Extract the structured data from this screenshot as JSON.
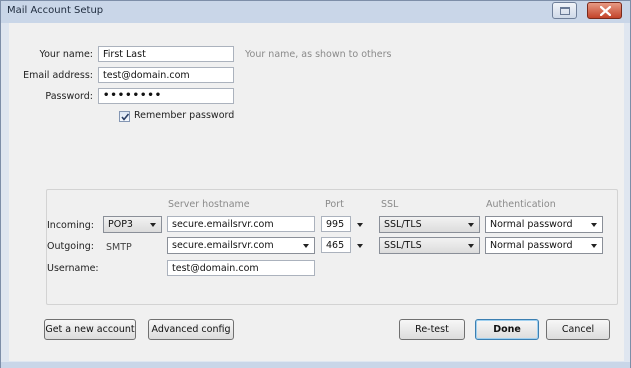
{
  "window": {
    "title": "Mail Account Setup"
  },
  "identity": {
    "name_label": "Your name:",
    "name_value": "First Last",
    "name_hint": "Your name, as shown to others",
    "email_label": "Email address:",
    "email_value": "test@domain.com",
    "password_label": "Password:",
    "password_value": "••••••••",
    "remember_label": "Remember password",
    "remember_checked": true
  },
  "server": {
    "headers": {
      "hostname": "Server hostname",
      "port": "Port",
      "ssl": "SSL",
      "auth": "Authentication"
    },
    "incoming": {
      "label": "Incoming:",
      "protocol": "POP3",
      "hostname": "secure.emailsrvr.com",
      "port": "995",
      "ssl": "SSL/TLS",
      "auth": "Normal password"
    },
    "outgoing": {
      "label": "Outgoing:",
      "protocol": "SMTP",
      "hostname": "secure.emailsrvr.com",
      "port": "465",
      "ssl": "SSL/TLS",
      "auth": "Normal password"
    },
    "username_label": "Username:",
    "username_value": "test@domain.com"
  },
  "buttons": {
    "new_account": "Get a new account",
    "advanced": "Advanced config",
    "retest": "Re-test",
    "done": "Done",
    "cancel": "Cancel"
  },
  "icons": {
    "maximize": "maximize-icon",
    "close": "close-icon",
    "checkmark": "checkmark-icon",
    "dropdown": "chevron-down-icon"
  }
}
